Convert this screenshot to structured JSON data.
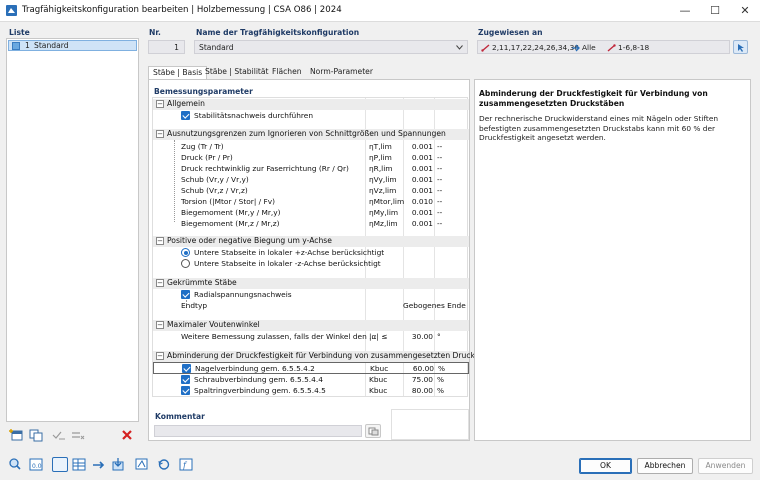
{
  "window": {
    "title": "Tragfähigkeitskonfiguration bearbeiten | Holzbemessung | CSA O86 | 2024"
  },
  "list": {
    "header": "Liste",
    "items": [
      {
        "number": "1",
        "name": "Standard"
      }
    ]
  },
  "nr": {
    "label": "Nr.",
    "value": "1"
  },
  "name_field": {
    "label": "Name der Tragfähigkeitskonfiguration",
    "value": "Standard"
  },
  "assigned": {
    "label": "Zugewiesen an",
    "members": "2,11,17,22,24,26,34,36",
    "sets": "Alle",
    "set_members": "1-6,8-18"
  },
  "tabs": [
    {
      "label": "Stäbe | Basis"
    },
    {
      "label": "Stäbe | Stabilität"
    },
    {
      "label": "Flächen"
    },
    {
      "label": "Norm-Parameter"
    }
  ],
  "params": {
    "title": "Bemessungsparameter",
    "general": {
      "header": "Allgemein",
      "stability_check": "Stabilitätsnachweis durchführen"
    },
    "utilization": {
      "header": "Ausnutzungsgrenzen zum Ignorieren von Schnittgrößen und Spannungen",
      "rows": [
        {
          "label": "Zug (Tr / Tr)",
          "symbol": "ηT,lim",
          "value": "0.001",
          "unit": "--"
        },
        {
          "label": "Druck (Pr / Pr)",
          "symbol": "ηP,lim",
          "value": "0.001",
          "unit": "--"
        },
        {
          "label": "Druck rechtwinklig zur Faserrichtung (Rr / Qr)",
          "symbol": "ηR,lim",
          "value": "0.001",
          "unit": "--"
        },
        {
          "label": "Schub (Vr,y / Vr,y)",
          "symbol": "ηVy,lim",
          "value": "0.001",
          "unit": "--"
        },
        {
          "label": "Schub (Vr,z / Vr,z)",
          "symbol": "ηVz,lim",
          "value": "0.001",
          "unit": "--"
        },
        {
          "label": "Torsion (|Mtor / Stor| / Fv)",
          "symbol": "ηMtor,lim",
          "value": "0.010",
          "unit": "--"
        },
        {
          "label": "Biegemoment (Mr,y / Mr,y)",
          "symbol": "ηMy,lim",
          "value": "0.001",
          "unit": "--"
        },
        {
          "label": "Biegemoment (Mr,z / Mr,z)",
          "symbol": "ηMz,lim",
          "value": "0.001",
          "unit": "--"
        }
      ]
    },
    "bending": {
      "header": "Positive oder negative Biegung um y-Achse",
      "opt1": "Untere Stabseite in lokaler +z-Achse berücksichtigt",
      "opt2": "Untere Stabseite in lokaler -z-Achse berücksichtigt"
    },
    "curved": {
      "header": "Gekrümmte Stäbe",
      "radial": "Radialspannungsnachweis",
      "end_type_label": "Endtyp",
      "end_type_value": "Gebogenes Ende"
    },
    "haunch": {
      "header": "Maximaler Voutenwinkel",
      "label": "Weitere Bemessung zulassen, falls der Winkel den ...",
      "symbol": "|α| ≤",
      "value": "30.00",
      "unit": "°"
    },
    "reduction": {
      "header": "Abminderung der Druckfestigkeit für Verbindung von zusammengesetzten Druckstäben",
      "rows": [
        {
          "label": "Nagelverbindung gem. 6.5.5.4.2",
          "symbol": "Kbuc",
          "value": "60.00",
          "unit": "%"
        },
        {
          "label": "Schraubverbindung gem. 6.5.5.4.4",
          "symbol": "Kbuc",
          "value": "75.00",
          "unit": "%"
        },
        {
          "label": "Spaltringverbindung gem. 6.5.5.4.5",
          "symbol": "Kbuc",
          "value": "80.00",
          "unit": "%"
        }
      ]
    }
  },
  "comment": {
    "label": "Kommentar",
    "value": ""
  },
  "info": {
    "title": "Abminderung der Druckfestigkeit für Verbindung von zusammengesetzten Druckstäben",
    "body": "Der rechnerische Druckwiderstand eines mit Nägeln oder Stiften befestigten zusammengesetzten Druckstabs kann mit 60 % der Druckfestigkeit angesetzt werden."
  },
  "buttons": {
    "ok": "OK",
    "cancel": "Abbrechen",
    "apply": "Anwenden"
  },
  "colors": {
    "accent": "#1f6fc6",
    "header_blue": "#1f3b66",
    "selection": "#cfe3f7",
    "delete_red": "#d42020"
  }
}
